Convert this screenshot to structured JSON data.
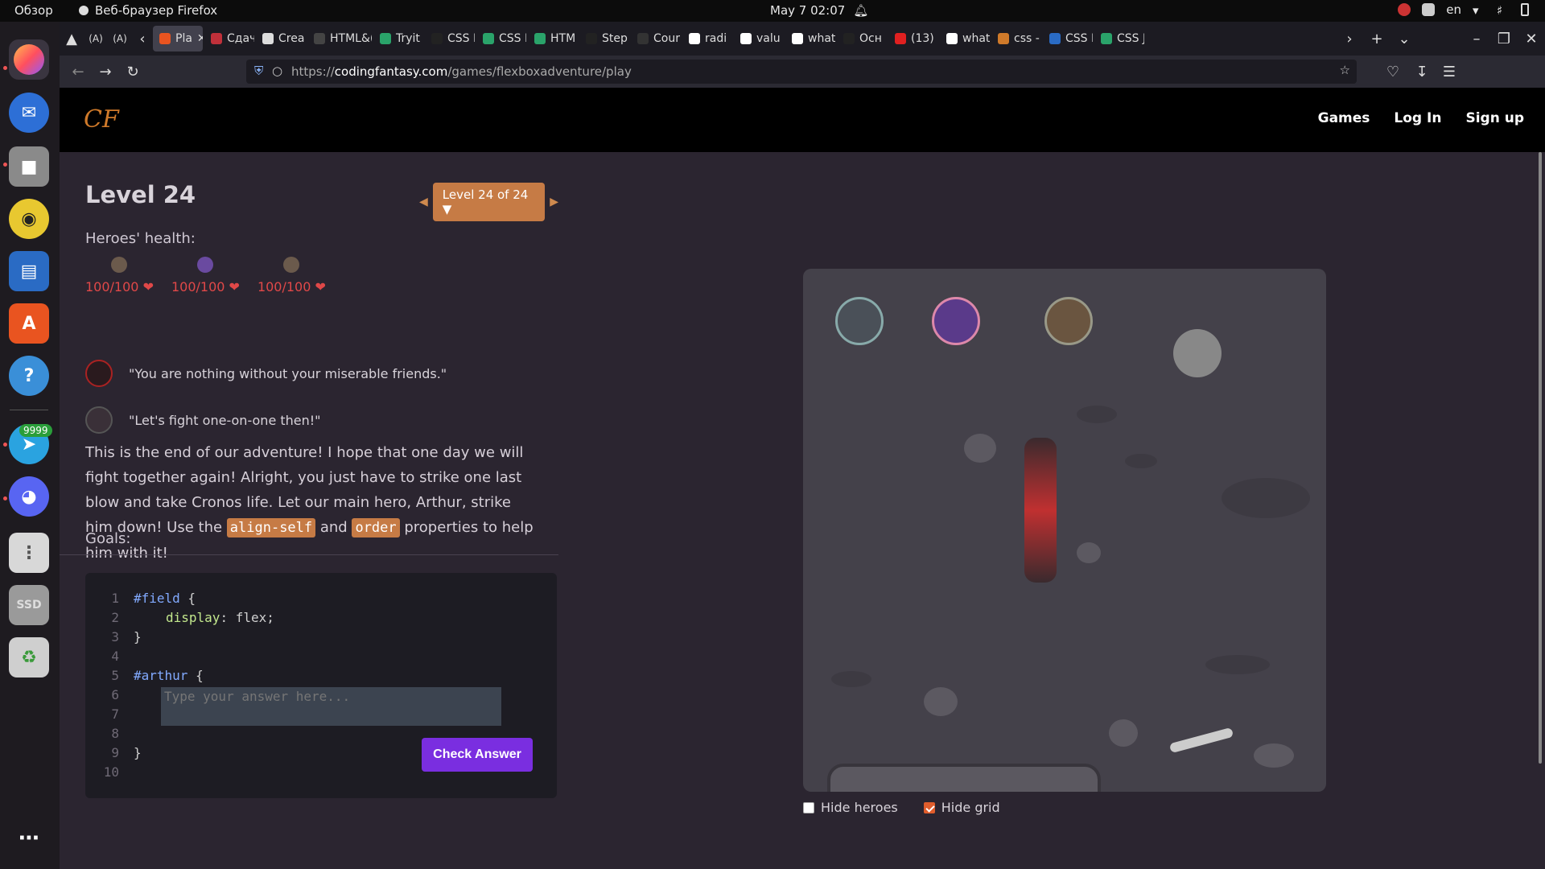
{
  "os": {
    "overview": "Обзор",
    "app_name": "Веб-браузер Firefox",
    "clock": "May 7  02:07",
    "lang": "en",
    "telegram_badge": "9999",
    "ssd_label": "SSD"
  },
  "browser": {
    "tabs": [
      {
        "label": "Pla",
        "active": true
      },
      {
        "label": "Сдач"
      },
      {
        "label": "Crea"
      },
      {
        "label": "HTML&("
      },
      {
        "label": "Tryit"
      },
      {
        "label": "CSS I"
      },
      {
        "label": "CSS I"
      },
      {
        "label": "HTM"
      },
      {
        "label": "Step"
      },
      {
        "label": "Cour"
      },
      {
        "label": "radi"
      },
      {
        "label": "valu"
      },
      {
        "label": "what"
      },
      {
        "label": "Осн"
      },
      {
        "label": "(13) I"
      },
      {
        "label": "what"
      },
      {
        "label": "css -"
      },
      {
        "label": "CSS I"
      },
      {
        "label": "CSS J"
      }
    ],
    "url_prefix": "https://",
    "url_domain": "codingfantasy.com",
    "url_path": "/games/flexboxadventure/play"
  },
  "site": {
    "logo": "CF",
    "nav": {
      "games": "Games",
      "login": "Log In",
      "signup": "Sign up"
    },
    "level_title": "Level 24",
    "level_select": "Level 24 of 24",
    "heroes_label": "Heroes' health:",
    "heroes": [
      {
        "hp": "100/100"
      },
      {
        "hp": "100/100"
      },
      {
        "hp": "100/100"
      }
    ],
    "quote_villain": "\"You are nothing without your miserable friends.\"",
    "quote_hero": "\"Let's fight one-on-one then!\"",
    "desc_1": "This is the end of our adventure! I hope that one day we will fight together again! Alright, you just have to strike one last blow and take Cronos life. Let our main hero, Arthur, strike him down! Use the ",
    "desc_code_1": "align-self",
    "desc_and": " and ",
    "desc_code_2": "order",
    "desc_2": " properties to help him with it!",
    "goals_label": "Goals:",
    "code": {
      "lines": [
        "1",
        "2",
        "3",
        "4",
        "5",
        "6",
        "7",
        "8",
        "9",
        "10"
      ],
      "field_selector": "#field",
      "brace_open": " {",
      "display_prop": "display",
      "display_val": ": flex;",
      "brace_close": "}",
      "arthur_selector": "#arthur",
      "placeholder": "Type your answer here...",
      "check_label": "Check Answer"
    },
    "options": {
      "hide_heroes": "Hide heroes",
      "hide_grid": "Hide grid",
      "hide_heroes_checked": false,
      "hide_grid_checked": true
    }
  },
  "colors": {
    "accent": "#c67b45",
    "button": "#7a2ee0",
    "health": "#e04848"
  }
}
